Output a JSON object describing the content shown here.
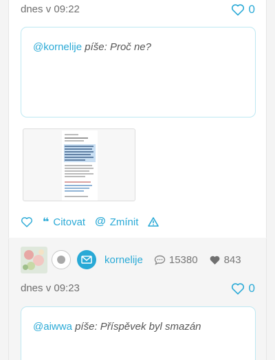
{
  "post1": {
    "timestamp": "dnes v 09:22",
    "likes": "0",
    "quote": {
      "mention": "@kornelije",
      "rest": " píše: Proč ne?"
    },
    "actions": {
      "cite_label": "Citovat",
      "mention_label": "Zmínit"
    }
  },
  "post2": {
    "author": {
      "name": "kornelije",
      "comments": "15380",
      "hearts": "843"
    },
    "timestamp": "dnes v 09:23",
    "likes": "0",
    "quote": {
      "mention": "@aiwwa",
      "rest": " píše: Příspěvek byl smazán"
    }
  },
  "icons": {
    "like": "heart-outline-icon",
    "cite": "quote-icon",
    "mention": "at-icon",
    "report": "warning-icon",
    "message": "envelope-icon",
    "comments": "speech-bubble-icon",
    "hearts": "heart-filled-icon"
  },
  "colors": {
    "accent": "#29a9d6",
    "quote_border": "#bde8f2",
    "text": "#555555"
  }
}
